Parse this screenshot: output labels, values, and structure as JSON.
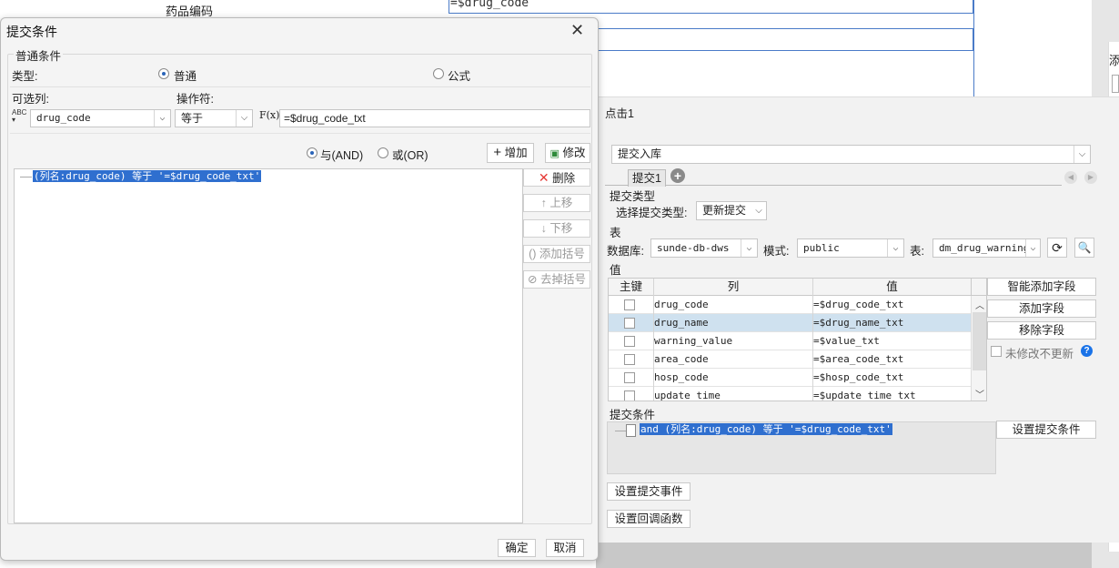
{
  "background": {
    "header_text": "药品编码",
    "code_cell": "=$drug_code",
    "add_char": "添"
  },
  "right_panel": {
    "title": "点击1",
    "action_select": "提交入库",
    "tab": "提交1",
    "submit_type_section": "提交类型",
    "submit_type_label": "选择提交类型:",
    "submit_type_value": "更新提交",
    "table_section": "表",
    "db_label": "数据库:",
    "db_value": "sunde-db-dws",
    "schema_label": "模式:",
    "schema_value": "public",
    "table_label": "表:",
    "table_value": "dm_drug_warning",
    "value_section": "值",
    "columns": {
      "pk": "主键",
      "col": "列",
      "val": "值"
    },
    "rows": [
      {
        "col": "drug_code",
        "val": "=$drug_code_txt"
      },
      {
        "col": "drug_name",
        "val": "=$drug_name_txt"
      },
      {
        "col": "warning_value",
        "val": "=$value_txt"
      },
      {
        "col": "area_code",
        "val": "=$area_code_txt"
      },
      {
        "col": "hosp_code",
        "val": "=$hosp_code_txt"
      },
      {
        "col": "update_time",
        "val": "=$update_time_txt"
      }
    ],
    "smart_add_btn": "智能添加字段",
    "add_field_btn": "添加字段",
    "remove_field_btn": "移除字段",
    "no_update_unmodified": "未修改不更新",
    "cond_section": "提交条件",
    "cond_item": "and (列名:drug_code) 等于 '=$drug_code_txt'",
    "set_cond_btn": "设置提交条件",
    "set_event_btn": "设置提交事件",
    "set_callback_btn": "设置回调函数"
  },
  "dialog": {
    "title": "提交条件",
    "group": "普通条件",
    "type_label": "类型:",
    "radio_normal": "普通",
    "radio_formula": "公式",
    "col_label": "可选列:",
    "op_label": "操作符:",
    "col_value": "drug_code",
    "op_value": "等于",
    "fx_label": "F(x)",
    "expr_value": "=$drug_code_txt",
    "and_label": "与(AND)",
    "or_label": "或(OR)",
    "add_btn": "增加",
    "modify_btn": "修改",
    "cond_item": "(列名:drug_code) 等于 '=$drug_code_txt'",
    "delete_btn": "删除",
    "up_btn": "上移",
    "down_btn": "下移",
    "add_bracket_btn": "添加括号",
    "remove_bracket_btn": "去掉括号",
    "ok_btn": "确定",
    "cancel_btn": "取消"
  }
}
